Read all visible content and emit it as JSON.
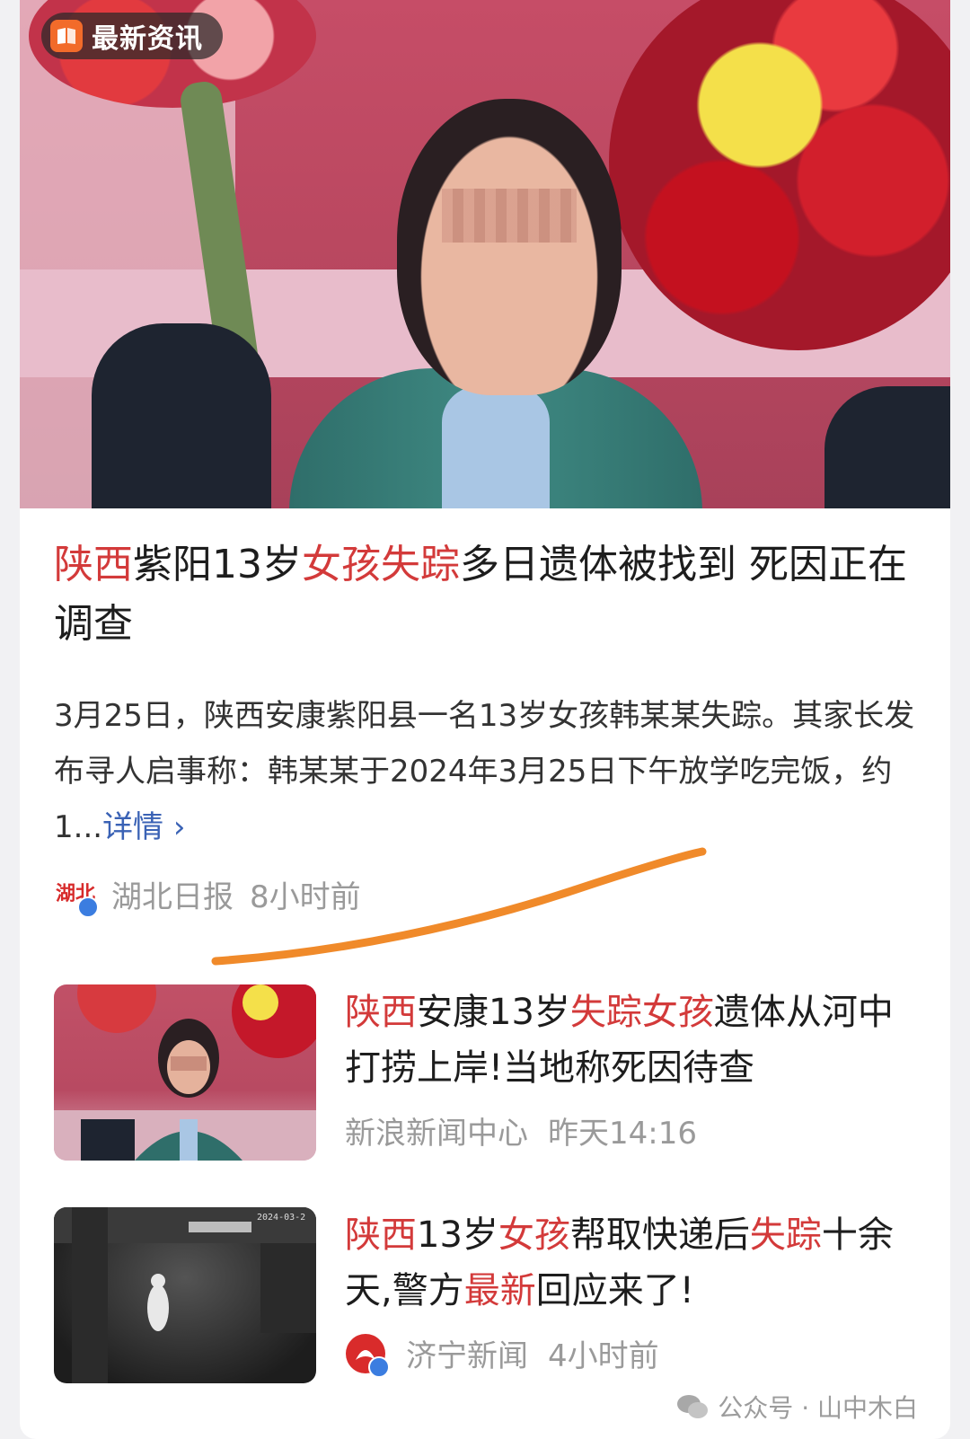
{
  "badge": {
    "label": "最新资讯",
    "icon": "news-book-icon",
    "accent": "#f26b2a"
  },
  "main_article": {
    "title_parts": [
      {
        "text": "陕西",
        "highlight": true
      },
      {
        "text": "紫阳13岁",
        "highlight": false
      },
      {
        "text": "女孩失踪",
        "highlight": true
      },
      {
        "text": "多日遗体被找到 死因正在调查",
        "highlight": false
      }
    ],
    "summary": "3月25日，陕西安康紫阳县一名13岁女孩韩某某失踪。其家长发布寻人启事称：韩某某于2024年3月25日下午放学吃完饭，约1...",
    "more_label": "详情 ›",
    "source": "湖北日报",
    "time": "8小时前",
    "source_logo_text": "湖北"
  },
  "related": [
    {
      "title_parts": [
        {
          "text": "陕西",
          "highlight": true
        },
        {
          "text": "安康13岁",
          "highlight": false
        },
        {
          "text": "失踪女孩",
          "highlight": true
        },
        {
          "text": "遗体从河中打捞上岸!当地称死因待查",
          "highlight": false
        }
      ],
      "source": "新浪新闻中心",
      "time": "昨天14:16"
    },
    {
      "title_parts": [
        {
          "text": "陕西",
          "highlight": true
        },
        {
          "text": "13岁",
          "highlight": false
        },
        {
          "text": "女孩",
          "highlight": true
        },
        {
          "text": "帮取快递后",
          "highlight": false
        },
        {
          "text": "失踪",
          "highlight": true
        },
        {
          "text": "十余天,警方",
          "highlight": false
        },
        {
          "text": "最新",
          "highlight": true
        },
        {
          "text": "回应来了!",
          "highlight": false
        }
      ],
      "source": "济宁新闻",
      "time": "4小时前",
      "thumb_text": "2024-03-2"
    }
  ],
  "watermark": "公众号 · 山中木白",
  "colors": {
    "highlight": "#d33a3a",
    "link": "#3a62b5",
    "meta": "#9a9a9a",
    "underline": "#f08a2a"
  }
}
